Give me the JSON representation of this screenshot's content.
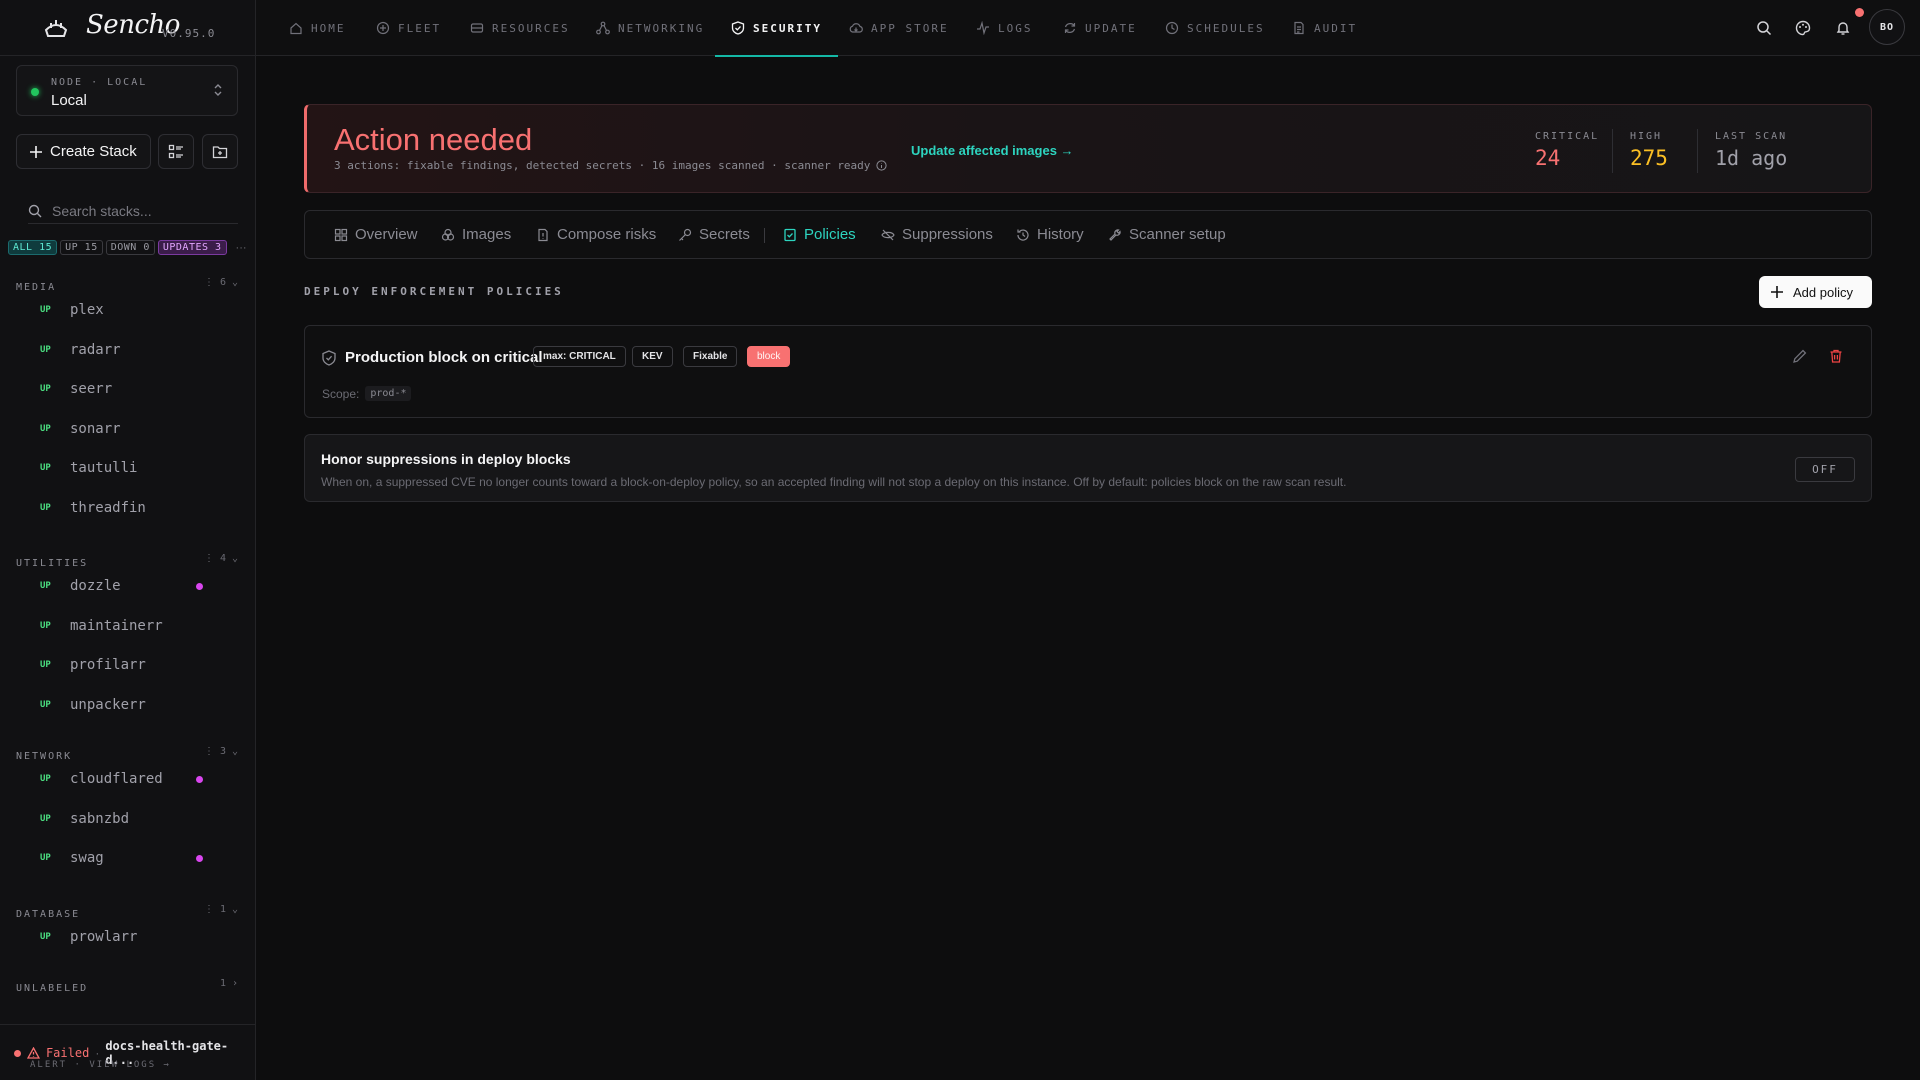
{
  "app": {
    "name": "Sencho",
    "version": "V0.95.0"
  },
  "node": {
    "label": "NODE · LOCAL",
    "value": "Local"
  },
  "sidebar": {
    "create_label": "Create Stack",
    "search_placeholder": "Search stacks...",
    "filters": {
      "all": "ALL 15",
      "up": "UP 15",
      "down": "DOWN 0",
      "updates": "UPDATES 3",
      "more": "···"
    },
    "groups": [
      {
        "name": "MEDIA",
        "count": "6",
        "stacks": [
          {
            "status": "UP",
            "name": "plex",
            "update": false
          },
          {
            "status": "UP",
            "name": "radarr",
            "update": false
          },
          {
            "status": "UP",
            "name": "seerr",
            "update": false
          },
          {
            "status": "UP",
            "name": "sonarr",
            "update": false
          },
          {
            "status": "UP",
            "name": "tautulli",
            "update": false
          },
          {
            "status": "UP",
            "name": "threadfin",
            "update": false
          }
        ]
      },
      {
        "name": "UTILITIES",
        "count": "4",
        "stacks": [
          {
            "status": "UP",
            "name": "dozzle",
            "update": true
          },
          {
            "status": "UP",
            "name": "maintainerr",
            "update": false
          },
          {
            "status": "UP",
            "name": "profilarr",
            "update": false
          },
          {
            "status": "UP",
            "name": "unpackerr",
            "update": false
          }
        ]
      },
      {
        "name": "NETWORK",
        "count": "3",
        "stacks": [
          {
            "status": "UP",
            "name": "cloudflared",
            "update": true
          },
          {
            "status": "UP",
            "name": "sabnzbd",
            "update": false
          },
          {
            "status": "UP",
            "name": "swag",
            "update": true
          }
        ]
      },
      {
        "name": "DATABASE",
        "count": "1",
        "stacks": [
          {
            "status": "UP",
            "name": "prowlarr",
            "update": false
          }
        ]
      },
      {
        "name": "UNLABELED",
        "count": "1",
        "stacks": []
      }
    ],
    "alert": {
      "status": "Failed",
      "job": "docs-health-gate-d...",
      "actions": "ALERT · VIEW LOGS →"
    }
  },
  "nav": {
    "items": [
      "HOME",
      "FLEET",
      "RESOURCES",
      "NETWORKING",
      "SECURITY",
      "APP STORE",
      "LOGS",
      "UPDATE",
      "SCHEDULES",
      "AUDIT"
    ],
    "active": "SECURITY",
    "avatar": "BO"
  },
  "banner": {
    "title": "Action needed",
    "subtitle": "3 actions: fixable findings, detected secrets · 16 images scanned · scanner ready",
    "cta": "Update affected images →",
    "stats": [
      {
        "label": "CRITICAL",
        "value": "24",
        "color": "#f87171"
      },
      {
        "label": "HIGH",
        "value": "275",
        "color": "#fbbf24"
      },
      {
        "label": "LAST SCAN",
        "value": "1d ago",
        "color": "#a1a1aa"
      }
    ]
  },
  "tabs": [
    "Overview",
    "Images",
    "Compose risks",
    "Secrets",
    "Policies",
    "Suppressions",
    "History",
    "Scanner setup"
  ],
  "active_tab": "Policies",
  "section": {
    "title": "DEPLOY ENFORCEMENT POLICIES",
    "add_label": "Add policy"
  },
  "policy": {
    "name": "Production block on critical",
    "chips": [
      "max: CRITICAL",
      "KEV",
      "Fixable"
    ],
    "action": "block",
    "scope_label": "Scope:",
    "scope": "prod-*"
  },
  "honor": {
    "title": "Honor suppressions in deploy blocks",
    "description": "When on, a suppressed CVE no longer counts toward a block-on-deploy policy, so an accepted finding will not stop a deploy on this instance. Off by default: policies block on the raw scan result.",
    "toggle": "OFF"
  }
}
